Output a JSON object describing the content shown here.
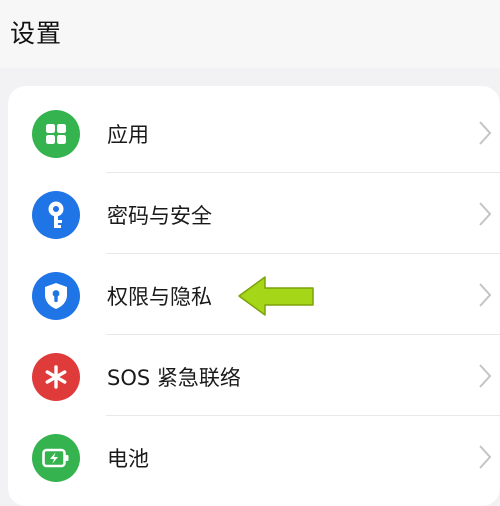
{
  "header": {
    "title": "设置"
  },
  "colors": {
    "apps": "#34b34f",
    "password": "#1f74e6",
    "privacy": "#1f74e6",
    "sos": "#e03b3b",
    "battery": "#34b34f",
    "annotation_arrow": "#a5d617"
  },
  "settings": {
    "items": [
      {
        "label": "应用",
        "icon": "apps-grid-icon"
      },
      {
        "label": "密码与安全",
        "icon": "key-icon"
      },
      {
        "label": "权限与隐私",
        "icon": "shield-lock-icon"
      },
      {
        "label": "SOS 紧急联络",
        "icon": "asterisk-icon"
      },
      {
        "label": "电池",
        "icon": "battery-icon"
      }
    ]
  },
  "annotation": {
    "icon": "left-arrow-annotation"
  }
}
